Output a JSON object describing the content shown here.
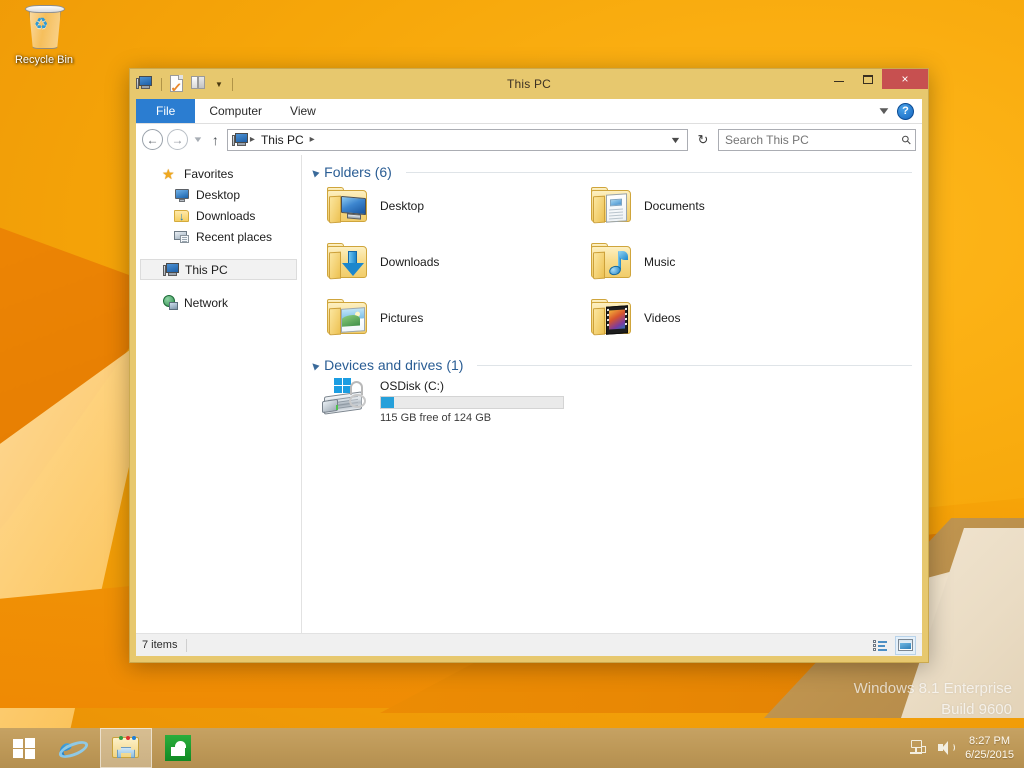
{
  "desktop": {
    "recycle_bin": {
      "label": "Recycle Bin",
      "icon": "recycle-bin-icon"
    },
    "watermark": {
      "line1": "Windows 8.1 Enterprise",
      "line2": "Build 9600"
    },
    "wallpaper_colors": {
      "primary": "#f5a50a",
      "accent": "#ef8705",
      "cream": "#f2e6d2",
      "khaki": "#c99d55"
    }
  },
  "window": {
    "title": "This PC",
    "quick_access": [
      {
        "name": "this-pc-icon",
        "label": "This PC"
      },
      {
        "name": "properties-icon",
        "label": "Properties"
      },
      {
        "name": "new-folder-icon",
        "label": "New folder"
      },
      {
        "name": "customize-qat-caret",
        "label": "Customize Quick Access Toolbar"
      }
    ],
    "controls": {
      "minimize": "—",
      "maximize": "□",
      "close": "×",
      "close_color": "#c75050"
    },
    "ribbon": {
      "tabs": [
        {
          "label": "File",
          "active": true
        },
        {
          "label": "Computer",
          "active": false
        },
        {
          "label": "View",
          "active": false
        }
      ],
      "expand_caret": "⌄",
      "help_label": "?"
    },
    "address_bar": {
      "back": "←",
      "forward": "→",
      "recent_caret": "⌄",
      "up": "↑",
      "crumbs": [
        "This PC"
      ],
      "separator": "▸",
      "dropdown_caret": "⌄",
      "refresh": "↻"
    },
    "search": {
      "placeholder": "Search This PC",
      "value": "",
      "icon": "search-icon"
    }
  },
  "navigation_pane": {
    "groups": [
      {
        "name": "favorites",
        "header": {
          "label": "Favorites",
          "icon": "star-icon"
        },
        "children": [
          {
            "label": "Desktop",
            "icon": "monitor-icon"
          },
          {
            "label": "Downloads",
            "icon": "downloads-folder-icon"
          },
          {
            "label": "Recent places",
            "icon": "recent-places-icon"
          }
        ]
      },
      {
        "name": "this-pc",
        "header": {
          "label": "This PC",
          "icon": "this-pc-icon",
          "selected": true
        },
        "children": []
      },
      {
        "name": "network",
        "header": {
          "label": "Network",
          "icon": "network-icon"
        },
        "children": []
      }
    ]
  },
  "content": {
    "groups": [
      {
        "id": "folders",
        "title": "Folders (6)",
        "expanded": true,
        "items": [
          {
            "label": "Desktop",
            "icon": "desktop-folder-icon"
          },
          {
            "label": "Documents",
            "icon": "documents-folder-icon"
          },
          {
            "label": "Downloads",
            "icon": "downloads-folder-icon"
          },
          {
            "label": "Music",
            "icon": "music-folder-icon"
          },
          {
            "label": "Pictures",
            "icon": "pictures-folder-icon"
          },
          {
            "label": "Videos",
            "icon": "videos-folder-icon"
          }
        ]
      },
      {
        "id": "devices",
        "title": "Devices and drives (1)",
        "expanded": true,
        "drives": [
          {
            "label": "OSDisk (C:)",
            "capacity_text": "115 GB free of 124 GB",
            "free_gb": 115,
            "total_gb": 124,
            "used_percent": 7,
            "bar_color": "#26a0da",
            "icon": "hard-drive-bitlocker-unlocked-icon"
          }
        ]
      }
    ]
  },
  "status_bar": {
    "item_count": "7 items",
    "views": [
      {
        "name": "details-view-button",
        "label": "Details view",
        "active": false
      },
      {
        "name": "large-icons-view-button",
        "label": "Large icons view",
        "active": true
      }
    ]
  },
  "taskbar": {
    "start": {
      "name": "start-button",
      "label": "Start"
    },
    "items": [
      {
        "name": "taskbar-internet-explorer",
        "label": "Internet Explorer",
        "active": false
      },
      {
        "name": "taskbar-file-explorer",
        "label": "File Explorer",
        "active": true
      },
      {
        "name": "taskbar-store",
        "label": "Store",
        "active": false
      }
    ],
    "tray": [
      {
        "name": "network-tray-icon",
        "label": "Network"
      },
      {
        "name": "volume-tray-icon",
        "label": "Speakers"
      }
    ],
    "clock": {
      "time": "8:27 PM",
      "date": "6/25/2015"
    }
  }
}
